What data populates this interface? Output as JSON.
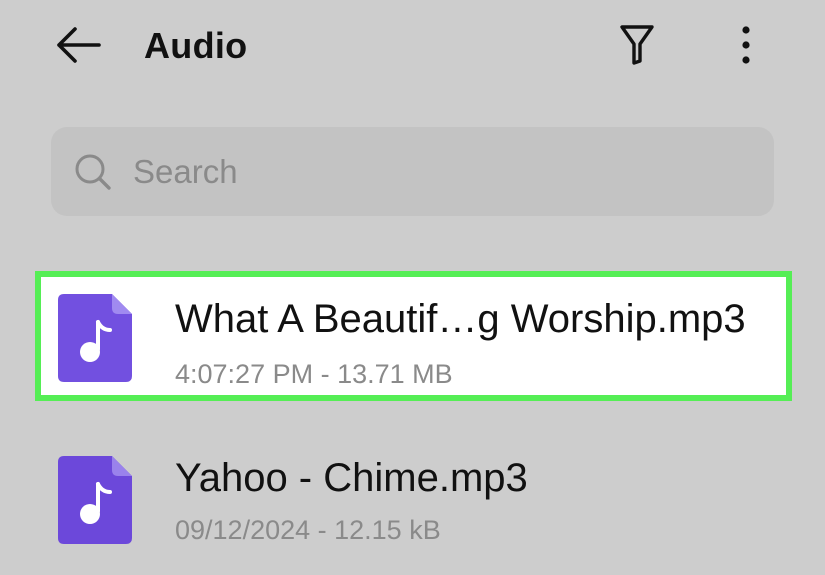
{
  "header": {
    "title": "Audio",
    "back_icon": "arrow-left-icon",
    "filter_icon": "filter-funnel-icon",
    "more_icon": "more-vertical-icon"
  },
  "search": {
    "placeholder": "Search",
    "value": "",
    "icon": "search-icon"
  },
  "files": [
    {
      "name": "What A Beautif…g Worship.mp3",
      "meta": "4:07:27 PM - 13.71 MB",
      "icon": "music-file-icon",
      "highlighted": true
    },
    {
      "name": "Yahoo - Chime.mp3",
      "meta": "09/12/2024 - 12.15 kB",
      "icon": "music-file-icon",
      "highlighted": false
    }
  ],
  "colors": {
    "background": "#cdcdcd",
    "search_bg": "#c3c3c3",
    "file_icon": "#7250e0",
    "highlight_border": "#55ee55",
    "meta_text": "#8a8a8a"
  }
}
